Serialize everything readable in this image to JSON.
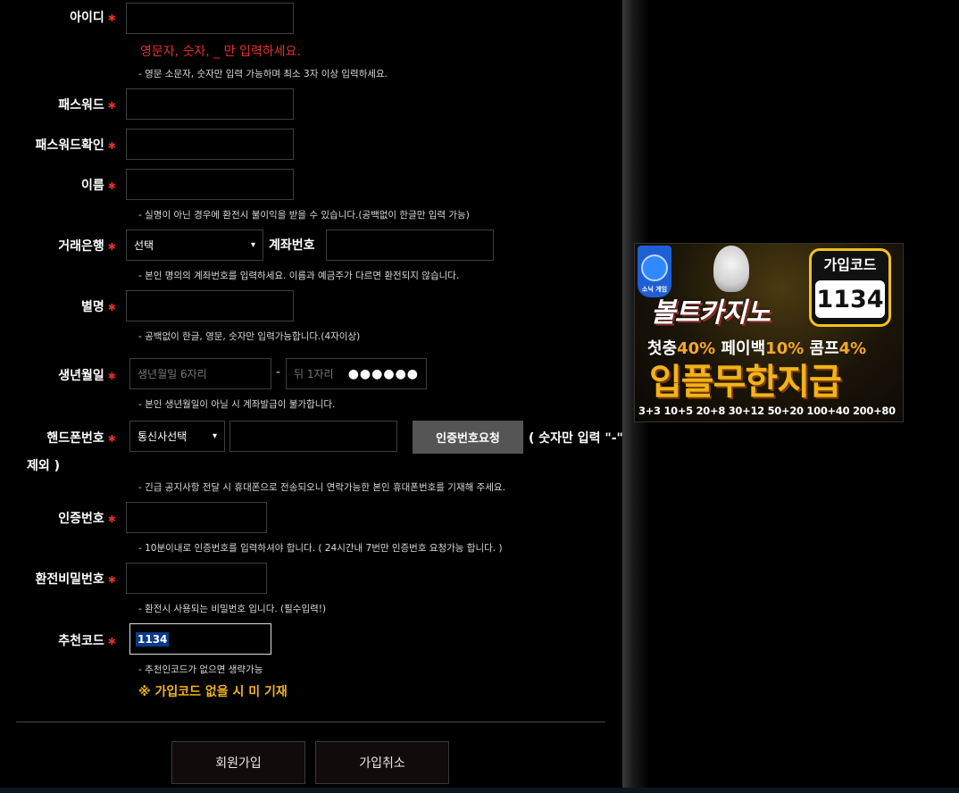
{
  "form": {
    "user_id": {
      "label": "아이디",
      "error": "영문자, 숫자, _ 만 입력하세요.",
      "hint": "- 영문 소문자, 숫자만 입력 가능하며 최소 3자 이상 입력하세요."
    },
    "password": {
      "label": "패스워드"
    },
    "password_confirm": {
      "label": "패스워드확인"
    },
    "name": {
      "label": "이름",
      "hint": "- 실명이 아닌 경우에 환전시 불이익을 받을 수 있습니다.(공백없이 한글만 입력 가능)"
    },
    "bank": {
      "label": "거래은행",
      "selected": "선택",
      "account_label": "계좌번호",
      "hint": "- 본인 명의의 계좌번호를 입력하세요. 이름과 예금주가 다르면 환전되지 않습니다."
    },
    "nickname": {
      "label": "별명",
      "hint": "- 공백없이 한글, 영문, 숫자만 입력가능합니다.(4자이상)"
    },
    "birth": {
      "label": "생년월일",
      "placeholder_front": "생년월일 6자리",
      "dash": "-",
      "placeholder_back": "뒤 1자리",
      "mask": "●●●●●●",
      "hint": "- 본인 생년월일이 아닐 시 계좌발급이 불가합니다."
    },
    "phone": {
      "label": "핸드폰번호",
      "carrier_selected": "통신사선택",
      "request_button": "인증번호요청",
      "note_part1": "( 숫자만 입력 \"-\"",
      "note_part2": "제외 )",
      "hint": "- 긴급 공지사항 전달 시 휴대폰으로 전송되오니 연락가능한 본인 휴대폰번호를 기재해 주세요."
    },
    "verify": {
      "label": "인증번호",
      "hint": "- 10분이내로 인증번호를 입력하셔야 합니다. ( 24시간내 7번만 인증번호 요청가능 합니다. )"
    },
    "withdraw_pw": {
      "label": "환전비밀번호",
      "hint": "- 환전시 사용되는 비밀번호 입니다. (필수입력!)"
    },
    "referral": {
      "label": "추천코드",
      "value": "1134",
      "hint": "- 추천인코드가 없으면 생략가능",
      "notice": "※ 가입코드 없을 시 미 기재"
    },
    "required_mark": "✱",
    "submit_button": "회원가입",
    "cancel_button": "가입취소"
  },
  "banner": {
    "badge_text": "소닉 게임",
    "code_title": "가입코드",
    "code_value": "1134",
    "brand": "볼트카지노",
    "line1_a": "첫충",
    "line1_b": "40%",
    "line1_c": " 페이백",
    "line1_d": "10%",
    "line1_e": " 콤프",
    "line1_f": "4%",
    "line2": "입플무한지급",
    "line3": "3+3 10+5 20+8 30+12 50+20 100+40 200+80"
  },
  "colors": {
    "required": "#e0302a",
    "accent_gold": "#f2b319",
    "background": "#000000",
    "button_gray": "#555555"
  }
}
